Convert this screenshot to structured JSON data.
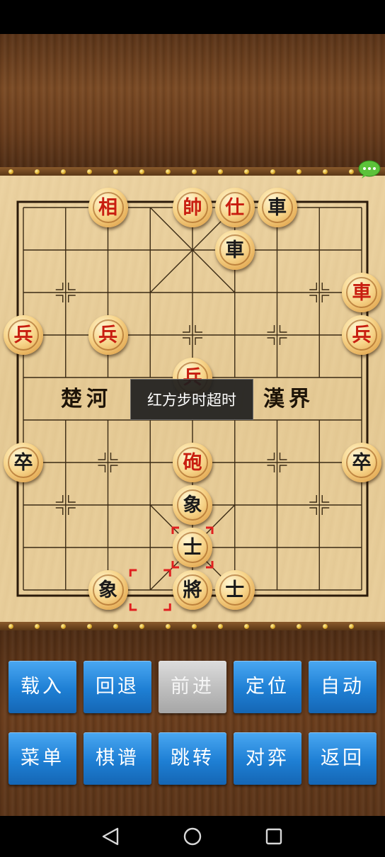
{
  "board": {
    "river": {
      "left_text": "楚河",
      "right_text": "漢界"
    },
    "pieces": [
      {
        "side": "red",
        "glyph": "相",
        "file": 2,
        "rank": 0
      },
      {
        "side": "red",
        "glyph": "帥",
        "file": 4,
        "rank": 0
      },
      {
        "side": "red",
        "glyph": "仕",
        "file": 5,
        "rank": 0
      },
      {
        "side": "black",
        "glyph": "車",
        "file": 6,
        "rank": 0
      },
      {
        "side": "black",
        "glyph": "車",
        "file": 5,
        "rank": 1
      },
      {
        "side": "red",
        "glyph": "車",
        "file": 8,
        "rank": 2
      },
      {
        "side": "red",
        "glyph": "兵",
        "file": 0,
        "rank": 3
      },
      {
        "side": "red",
        "glyph": "兵",
        "file": 2,
        "rank": 3
      },
      {
        "side": "red",
        "glyph": "兵",
        "file": 8,
        "rank": 3
      },
      {
        "side": "red",
        "glyph": "兵",
        "file": 4,
        "rank": 4
      },
      {
        "side": "black",
        "glyph": "卒",
        "file": 0,
        "rank": 6
      },
      {
        "side": "red",
        "glyph": "砲",
        "file": 4,
        "rank": 6
      },
      {
        "side": "black",
        "glyph": "卒",
        "file": 8,
        "rank": 6
      },
      {
        "side": "black",
        "glyph": "象",
        "file": 4,
        "rank": 7
      },
      {
        "side": "black",
        "glyph": "士",
        "file": 4,
        "rank": 8
      },
      {
        "side": "black",
        "glyph": "象",
        "file": 2,
        "rank": 9
      },
      {
        "side": "black",
        "glyph": "將",
        "file": 4,
        "rank": 9
      },
      {
        "side": "black",
        "glyph": "士",
        "file": 5,
        "rank": 9
      }
    ],
    "last_move": {
      "from": {
        "file": 3,
        "rank": 9
      },
      "to": {
        "file": 4,
        "rank": 8
      }
    }
  },
  "toast": {
    "message": "红方步时超时"
  },
  "buttons": {
    "load": "载入",
    "undo": "回退",
    "forward": "前进",
    "locate": "定位",
    "auto": "自动",
    "menu": "菜单",
    "records": "棋谱",
    "jump": "跳转",
    "vs": "对弈",
    "back": "返回"
  },
  "colors": {
    "red_piece_text": "#c81e10",
    "black_piece_text": "#1a1a1a",
    "button_blue": "#1e7fd4",
    "button_disabled": "#bdbdbd",
    "selection_marker": "#e02020"
  },
  "icons": {
    "chat": "chat-bubble-icon",
    "nav_back": "triangle-back-icon",
    "nav_home": "circle-home-icon",
    "nav_recent": "square-recent-icon"
  }
}
